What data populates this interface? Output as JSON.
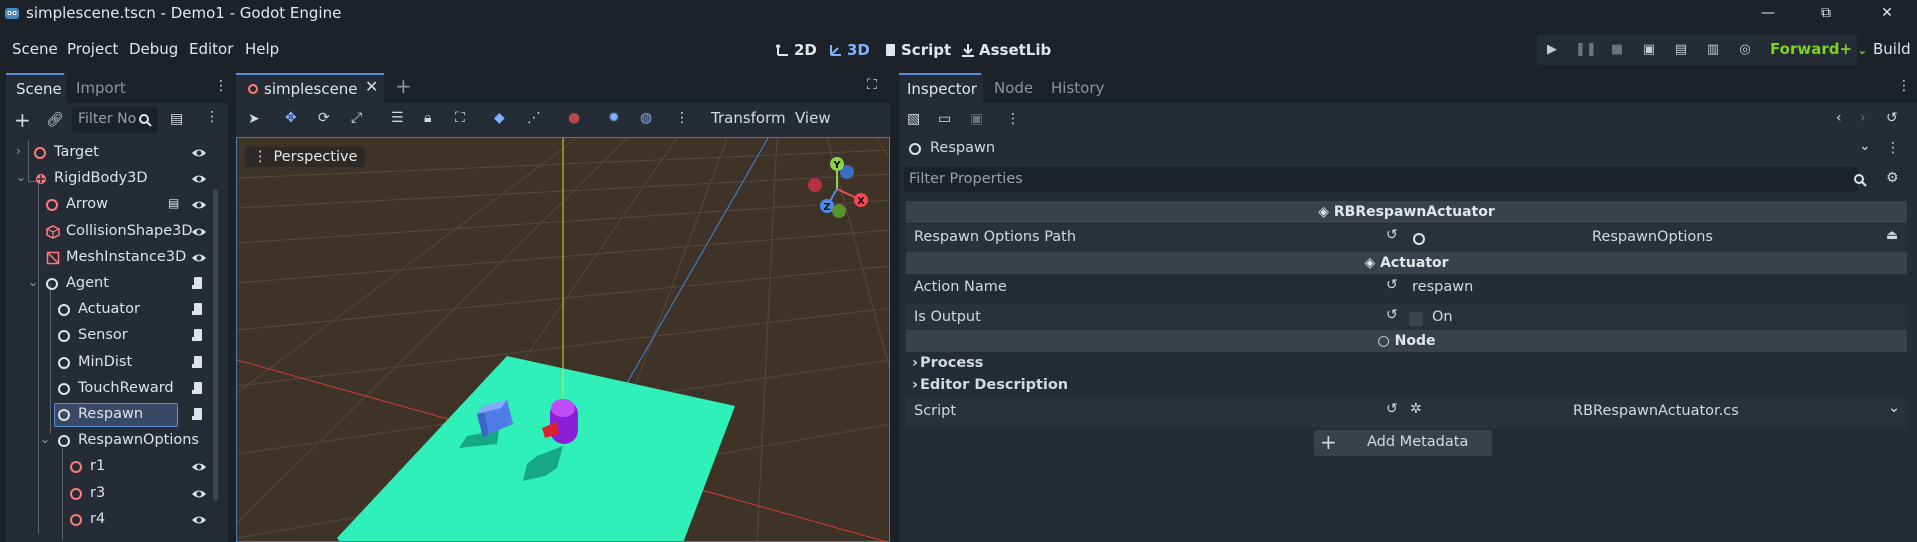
{
  "window": {
    "title": "simplescene.tscn - Demo1 - Godot Engine",
    "minimize_glyph": "—",
    "maximize_glyph": "⧉",
    "close_glyph": "✕"
  },
  "menu": {
    "items": [
      "Scene",
      "Project",
      "Debug",
      "Editor",
      "Help"
    ]
  },
  "workspaces": {
    "d2": "2D",
    "d3": "3D",
    "script": "Script",
    "assetlib": "AssetLib"
  },
  "run_bar": {
    "renderer": "Forward+",
    "build": "Build"
  },
  "scene_dock": {
    "tabs": [
      "Scene",
      "Import"
    ],
    "filter_placeholder": "Filter No",
    "nodes": [
      {
        "label": "Target",
        "icon": "node3d-icon",
        "visibility": "eye-icon"
      },
      {
        "label": "RigidBody3D",
        "icon": "rigidbody-icon",
        "visibility": "eye-icon"
      },
      {
        "label": "Arrow",
        "icon": "node3d-icon",
        "visibility": "eye-icon"
      },
      {
        "label": "CollisionShape3D",
        "icon": "collision-shape-icon",
        "visibility": "eye-icon"
      },
      {
        "label": "MeshInstance3D",
        "icon": "mesh-instance-icon",
        "visibility": "eye-icon"
      },
      {
        "label": "Agent",
        "icon": "node-icon",
        "visibility": "script-icon"
      },
      {
        "label": "Actuator",
        "icon": "node-icon",
        "visibility": "script-icon"
      },
      {
        "label": "Sensor",
        "icon": "node-icon",
        "visibility": "script-icon"
      },
      {
        "label": "MinDist",
        "icon": "node-icon",
        "visibility": "script-icon"
      },
      {
        "label": "TouchReward",
        "icon": "node-icon",
        "visibility": "script-icon"
      },
      {
        "label": "Respawn",
        "icon": "node-icon",
        "visibility": "script-icon",
        "selected": true
      },
      {
        "label": "RespawnOptions",
        "icon": "node-icon"
      },
      {
        "label": "r1",
        "icon": "node3d-icon",
        "visibility": "eye-icon"
      },
      {
        "label": "r3",
        "icon": "node3d-icon",
        "visibility": "eye-icon"
      },
      {
        "label": "r4",
        "icon": "node3d-icon",
        "visibility": "eye-icon"
      }
    ]
  },
  "editor": {
    "tab_label": "simplescene",
    "toolbar": {
      "transform": "Transform",
      "view": "View"
    },
    "viewport_label": "Perspective",
    "gizmo": {
      "y": "Y",
      "x": "X",
      "z": "Z"
    }
  },
  "inspector": {
    "tabs": [
      "Inspector",
      "Node",
      "History"
    ],
    "object_name": "Respawn",
    "filter_placeholder": "Filter Properties",
    "sections": {
      "class": "RBRespawnActuator",
      "actuator": "Actuator",
      "node": "Node"
    },
    "properties": {
      "respawn_options_path": {
        "label": "Respawn Options Path",
        "value": "RespawnOptions"
      },
      "action_name": {
        "label": "Action Name",
        "value": "respawn"
      },
      "is_output": {
        "label": "Is Output",
        "value": "On"
      },
      "process": "Process",
      "editor_description": "Editor Description",
      "script": {
        "label": "Script",
        "value": "RBRespawnActuator.cs"
      }
    },
    "add_metadata": "Add Metadata"
  },
  "colors": {
    "accent": "#5a8fd8",
    "bg_dark": "#1d2229",
    "panel": "#262c35",
    "floor": "#2ff0b8",
    "renderer": "#7ed321"
  }
}
